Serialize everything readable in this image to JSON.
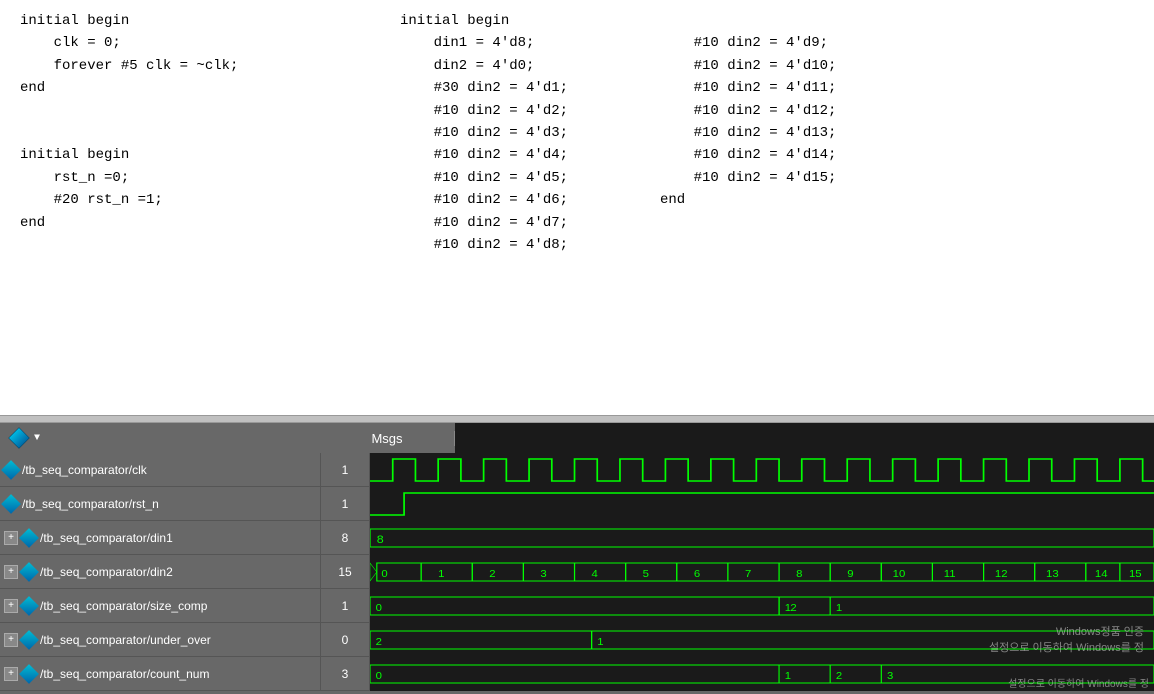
{
  "code": {
    "col1": {
      "lines": [
        "initial begin",
        "    clk = 0;",
        "    forever #5 clk = ~clk;",
        "end",
        "",
        "",
        "initial begin",
        "    rst_n =0;",
        "    #20 rst_n =1;",
        "end"
      ]
    },
    "col2": {
      "lines": [
        "initial begin",
        "    din1 = 4'd8;",
        "    din2 = 4'd0;",
        "    #30 din2 = 4'd1;",
        "    #10 din2 = 4'd2;",
        "    #10 din2 = 4'd3;",
        "    #10 din2 = 4'd4;",
        "    #10 din2 = 4'd5;",
        "    #10 din2 = 4'd6;",
        "    #10 din2 = 4'd7;",
        "    #10 din2 = 4'd8;"
      ]
    },
    "col3": {
      "lines": [
        "",
        "#10 din2 = 4'd9;",
        "#10 din2 = 4'd10;",
        "#10 din2 = 4'd11;",
        "#10 din2 = 4'd12;",
        "#10 din2 = 4'd13;",
        "#10 din2 = 4'd14;",
        "#10 din2 = 4'd15;",
        "end"
      ]
    }
  },
  "waveform": {
    "msgs_label": "Msgs",
    "signals": [
      {
        "name": "/tb_seq_comparator/clk",
        "value": "1",
        "has_expand": false
      },
      {
        "name": "/tb_seq_comparator/rst_n",
        "value": "1",
        "has_expand": false
      },
      {
        "name": "/tb_seq_comparator/din1",
        "value": "8",
        "has_expand": true
      },
      {
        "name": "/tb_seq_comparator/din2",
        "value": "15",
        "has_expand": true
      },
      {
        "name": "/tb_seq_comparator/size_comp",
        "value": "1",
        "has_expand": true
      },
      {
        "name": "/tb_seq_comparator/under_over",
        "value": "0",
        "has_expand": true
      },
      {
        "name": "/tb_seq_comparator/count_num",
        "value": "3",
        "has_expand": true
      }
    ],
    "watermark": {
      "line1": "Windows정품 인증",
      "line2": "설정으로 이동하여 Windows를 정"
    }
  }
}
